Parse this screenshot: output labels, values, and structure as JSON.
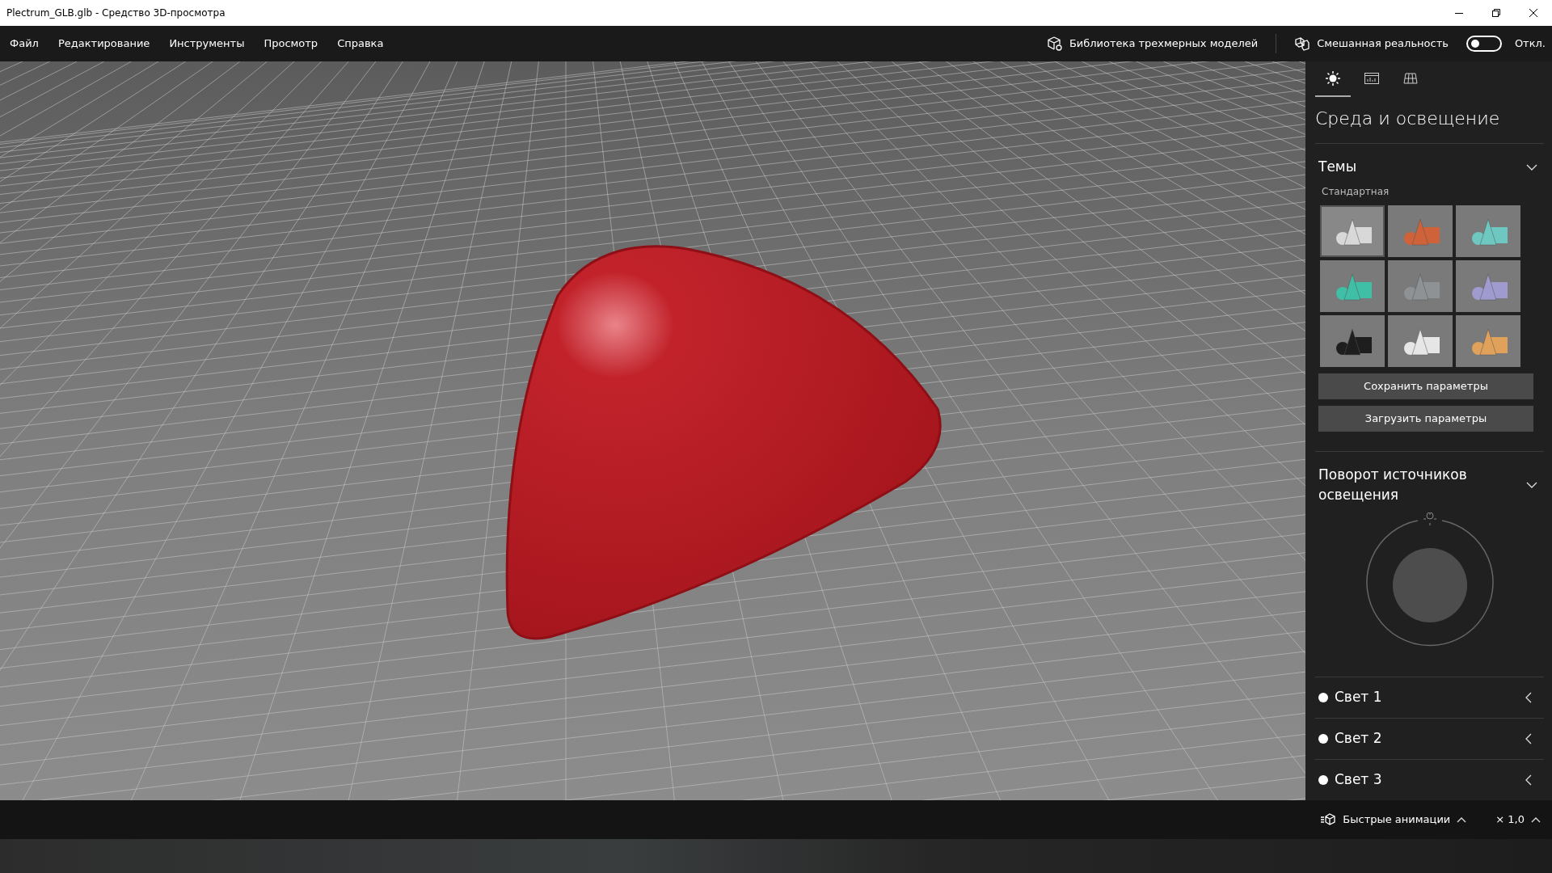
{
  "window": {
    "title": "Plectrum_GLB.glb - Средство 3D-просмотра"
  },
  "menu": [
    "Файл",
    "Редактирование",
    "Инструменты",
    "Просмотр",
    "Справка"
  ],
  "toolbar": {
    "library": "Библиотека трехмерных моделей",
    "mixed_reality": {
      "label": "Смешанная реальность",
      "on": false,
      "state_text": "Откл."
    }
  },
  "panel_tabs": [
    {
      "kind": "lighting",
      "selected": true
    },
    {
      "kind": "stats",
      "selected": false
    },
    {
      "kind": "grid",
      "selected": false
    }
  ],
  "panel": {
    "title": "Среда и освещение",
    "themes": {
      "title": "Темы",
      "expanded": true,
      "group": "Стандартная",
      "items": [
        {
          "color": "#d8d8d8",
          "selected": true
        },
        {
          "color": "#d0623a",
          "selected": false
        },
        {
          "color": "#6fc7c2",
          "selected": false
        },
        {
          "color": "#3fbfa5",
          "selected": false
        },
        {
          "color": "#8e9294",
          "selected": false
        },
        {
          "color": "#9f9bcf",
          "selected": false
        },
        {
          "color": "#1e1e1e",
          "selected": false
        },
        {
          "color": "#e6e6e6",
          "selected": false
        },
        {
          "color": "#e0a15a",
          "selected": false
        }
      ],
      "buttons": [
        "Сохранить параметры",
        "Загрузить параметры"
      ]
    },
    "rotation": {
      "title": "Поворот источников освещения",
      "expanded": true
    },
    "lights": [
      {
        "label": "Свет 1",
        "expanded": false
      },
      {
        "label": "Свет 2",
        "expanded": false
      },
      {
        "label": "Свет 3",
        "expanded": false
      }
    ]
  },
  "status_bar": {
    "animations": "Быстрые анимации",
    "speed": "× 1,0"
  }
}
